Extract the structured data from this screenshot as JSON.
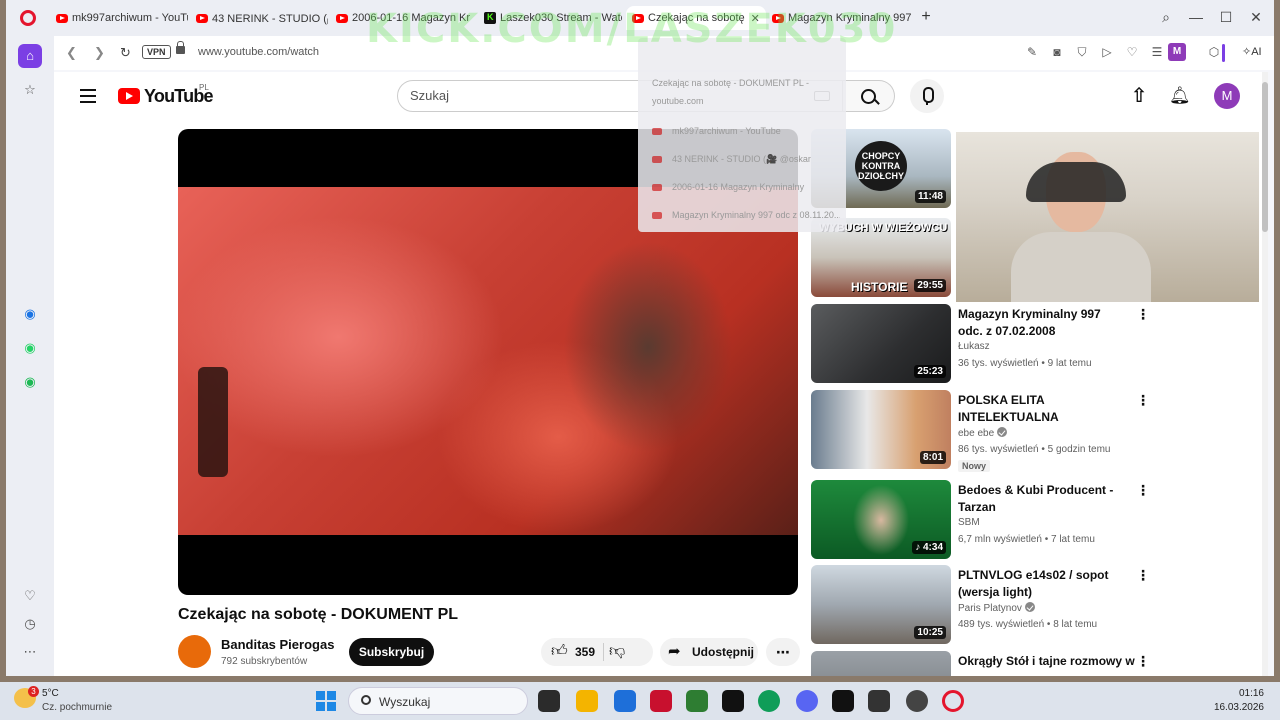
{
  "browser": {
    "tabs": [
      {
        "label": "mk997archiwum - YouTub",
        "type": "youtube"
      },
      {
        "label": "43 NERINK - STUDIO (🎥 @",
        "type": "youtube"
      },
      {
        "label": "2006-01-16 Magazyn Krym",
        "type": "youtube"
      },
      {
        "label": "Laszek030 Stream - Watch",
        "type": "kick"
      },
      {
        "label": "Czekając na sobotę",
        "type": "youtube",
        "active": true
      },
      {
        "label": "Magazyn Kryminalny 997",
        "type": "youtube"
      }
    ],
    "vpn_label": "VPN",
    "url": "www.youtube.com/watch",
    "profile_letter": "M",
    "ai_label": "AI"
  },
  "overlay": {
    "watermark": "KICK.COM/LASZEK030",
    "preview_lines": [
      "Czekając na sobotę - DOKUMENT PL -",
      "youtube.com",
      "mk997archiwum - YouTube",
      "43 NERINK - STUDIO (🎥 @oskar",
      "2006-01-16 Magazyn Kryminalny",
      "Magazyn Kryminalny 997 odc z 08.11.20..."
    ]
  },
  "youtube": {
    "logo_text": "YouTube",
    "region": "PL",
    "search_placeholder": "Szukaj",
    "avatar_letter": "M",
    "video": {
      "title": "Czekając na sobotę - DOKUMENT PL",
      "channel": "Banditas Pierogas",
      "subscribers": "792 subskrybentów",
      "subscribe_label": "Subskrybuj",
      "likes": "359",
      "share_label": "Udostępnij"
    },
    "recommendations": [
      {
        "title": "",
        "channel": "",
        "meta": "",
        "duration": "11:48",
        "thumb_text": "CHOPCY KONTRA DZIOŁCHY"
      },
      {
        "title": "",
        "channel": "",
        "meta": "",
        "duration": "29:55",
        "thumb_text_top": "WYBUCH W WIEŻOWCU",
        "thumb_text_bottom": "HISTORIE"
      },
      {
        "title": "Magazyn Kryminalny 997 odc. z 07.02.2008",
        "channel": "Łukasz",
        "meta": "36 tys. wyświetleń • 9 lat temu",
        "duration": "25:23"
      },
      {
        "title": "POLSKA ELITA INTELEKTUALNA",
        "channel": "ebe ebe",
        "meta": "86 tys. wyświetleń • 5 godzin temu",
        "duration": "8:01",
        "badge": "Nowy",
        "verified": true
      },
      {
        "title": "Bedoes & Kubi Producent - Tarzan",
        "channel": "SBM",
        "meta": "6,7 mln wyświetleń • 7 lat temu",
        "duration": "4:34"
      },
      {
        "title": "PLTNVLOG e14s02 / sopot (wersja light)",
        "channel": "Paris Platynov",
        "meta": "489 tys. wyświetleń • 8 lat temu",
        "duration": "10:25",
        "verified": true
      },
      {
        "title": "Okrągły Stół i tajne rozmowy w",
        "channel": "",
        "meta": "",
        "duration": ""
      }
    ]
  },
  "taskbar": {
    "weather_temp": "5°C",
    "weather_desc": "Cz. pochmurnie",
    "weather_badge": "3",
    "search_label": "Wyszukaj",
    "time": "01:16",
    "date": "16.03.2026"
  }
}
